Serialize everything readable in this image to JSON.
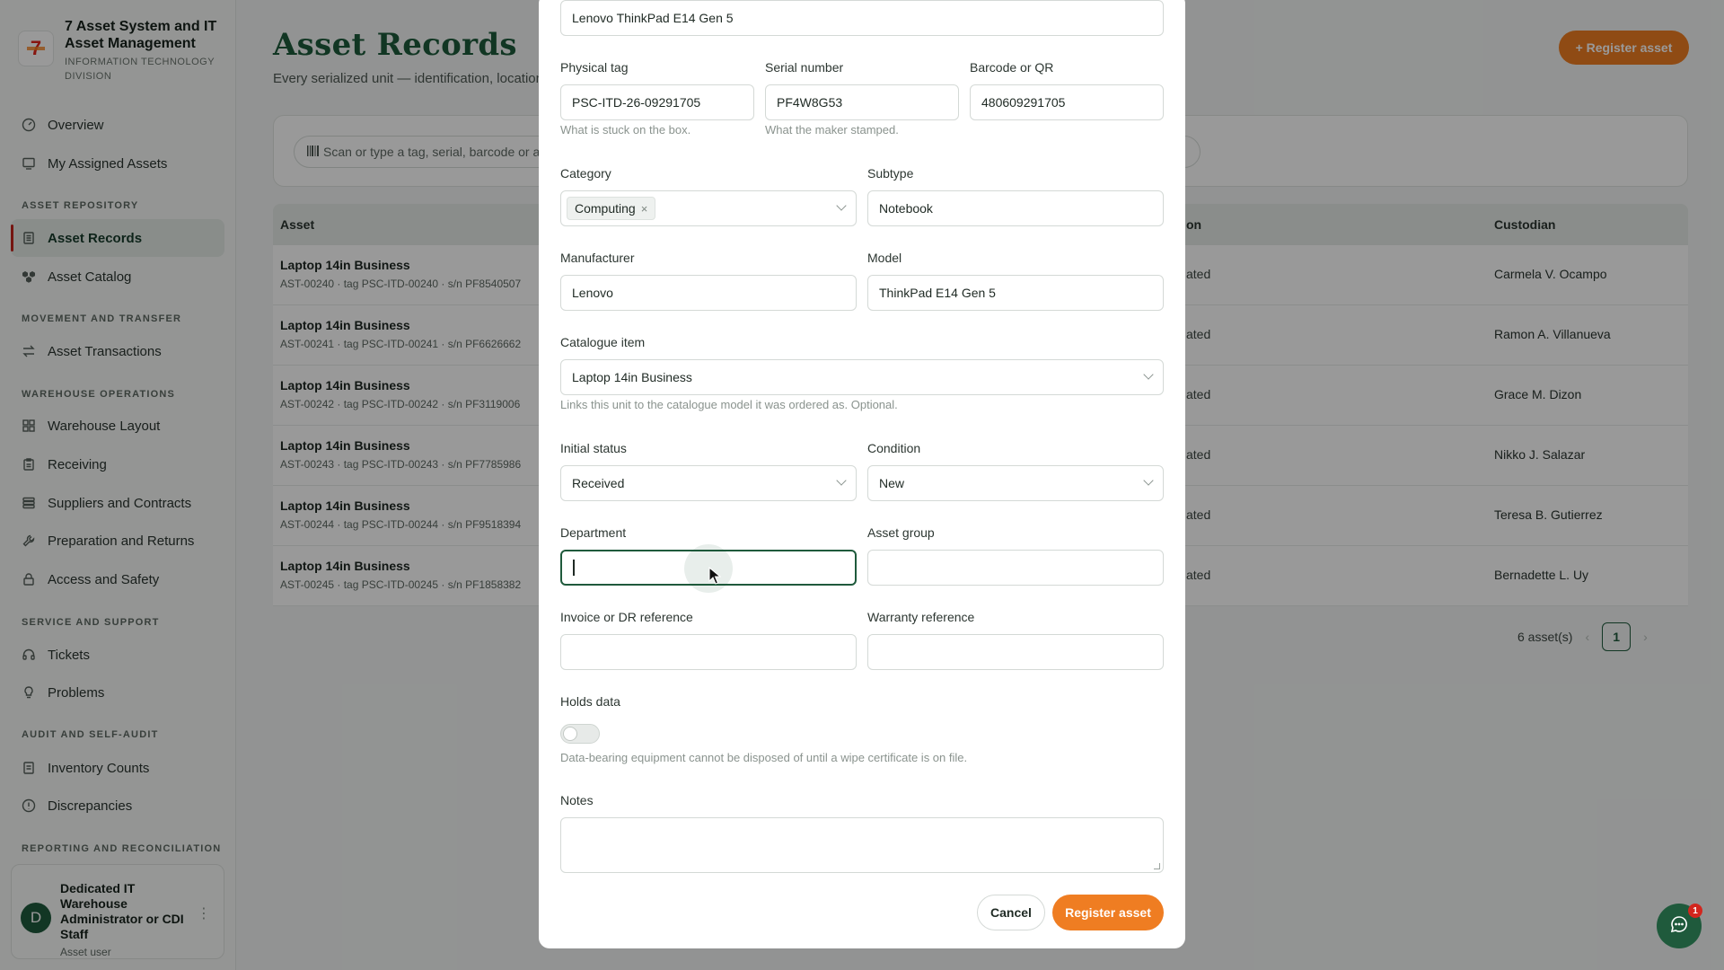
{
  "brand": {
    "title": "7 Asset System and IT Asset Management",
    "subtitle": "INFORMATION TECHNOLOGY DIVISION"
  },
  "sidebar": {
    "items": [
      {
        "label": "Overview",
        "icon": "gauge-icon"
      },
      {
        "label": "My Assigned Assets",
        "icon": "monitor-icon"
      },
      {
        "label": "Asset Records",
        "icon": "records-icon"
      },
      {
        "label": "Asset Catalog",
        "icon": "boxes-icon"
      },
      {
        "label": "Asset Transactions",
        "icon": "transfer-icon"
      },
      {
        "label": "Warehouse Layout",
        "icon": "grid-icon"
      },
      {
        "label": "Receiving",
        "icon": "clipboard-icon"
      },
      {
        "label": "Suppliers and Contracts",
        "icon": "stack-icon"
      },
      {
        "label": "Preparation and Returns",
        "icon": "wrench-icon"
      },
      {
        "label": "Access and Safety",
        "icon": "lock-icon"
      },
      {
        "label": "Tickets",
        "icon": "headset-icon"
      },
      {
        "label": "Problems",
        "icon": "lightbulb-icon"
      },
      {
        "label": "Inventory Counts",
        "icon": "list-icon"
      },
      {
        "label": "Discrepancies",
        "icon": "alert-circle-icon"
      }
    ],
    "sections": [
      "ASSET REPOSITORY",
      "MOVEMENT AND TRANSFER",
      "WAREHOUSE OPERATIONS",
      "SERVICE AND SUPPORT",
      "AUDIT AND SELF-AUDIT",
      "REPORTING AND RECONCILIATION"
    ],
    "active": "Asset Records"
  },
  "user": {
    "initial": "D",
    "name": "Dedicated IT Warehouse Administrator or CDI Staff",
    "role": "Asset user"
  },
  "main": {
    "title": "Asset Records",
    "subtitle": "Every serialized unit — identification, location",
    "register_button": "+ Register asset",
    "search_placeholder": "Scan or type a tag, serial, barcode or as",
    "columns": [
      "Asset",
      "on",
      "Custodian"
    ],
    "rows": [
      {
        "name": "Laptop 14in Business",
        "meta": "AST-00240 · tag PSC-ITD-00240 · s/n PF8540507",
        "status": "ated",
        "custodian": "Carmela V. Ocampo"
      },
      {
        "name": "Laptop 14in Business",
        "meta": "AST-00241 · tag PSC-ITD-00241 · s/n PF6626662",
        "status": "ated",
        "custodian": "Ramon A. Villanueva"
      },
      {
        "name": "Laptop 14in Business",
        "meta": "AST-00242 · tag PSC-ITD-00242 · s/n PF3119006",
        "status": "ated",
        "custodian": "Grace M. Dizon"
      },
      {
        "name": "Laptop 14in Business",
        "meta": "AST-00243 · tag PSC-ITD-00243 · s/n PF7785986",
        "status": "ated",
        "custodian": "Nikko J. Salazar"
      },
      {
        "name": "Laptop 14in Business",
        "meta": "AST-00244 · tag PSC-ITD-00244 · s/n PF9518394",
        "status": "ated",
        "custodian": "Teresa B. Gutierrez"
      },
      {
        "name": "Laptop 14in Business",
        "meta": "AST-00245 · tag PSC-ITD-00245 · s/n PF1858382",
        "status": "ated",
        "custodian": "Bernadette L. Uy"
      }
    ],
    "pager": {
      "count": "6 asset(s)",
      "page": "1",
      "prev": "‹",
      "next": "›"
    }
  },
  "modal": {
    "name_value": "Lenovo ThinkPad E14 Gen 5",
    "physical_tag": {
      "label": "Physical tag",
      "value": "PSC-ITD-26-09291705",
      "hint": "What is stuck on the box."
    },
    "serial": {
      "label": "Serial number",
      "value": "PF4W8G53",
      "hint": "What the maker stamped."
    },
    "barcode": {
      "label": "Barcode or QR",
      "value": "480609291705"
    },
    "category": {
      "label": "Category",
      "chip": "Computing",
      "chip_remove": "×"
    },
    "subtype": {
      "label": "Subtype",
      "value": "Notebook"
    },
    "manufacturer": {
      "label": "Manufacturer",
      "value": "Lenovo"
    },
    "model": {
      "label": "Model",
      "value": "ThinkPad E14 Gen 5"
    },
    "catalogue": {
      "label": "Catalogue item",
      "value": "Laptop 14in Business",
      "hint": "Links this unit to the catalogue model it was ordered as. Optional."
    },
    "initial_status": {
      "label": "Initial status",
      "value": "Received"
    },
    "condition": {
      "label": "Condition",
      "value": "New"
    },
    "department": {
      "label": "Department",
      "value": ""
    },
    "asset_group": {
      "label": "Asset group",
      "value": ""
    },
    "invoice": {
      "label": "Invoice or DR reference",
      "value": ""
    },
    "warranty": {
      "label": "Warranty reference",
      "value": ""
    },
    "holds_data": {
      "label": "Holds data",
      "on": false,
      "hint": "Data-bearing equipment cannot be disposed of until a wipe certificate is on file."
    },
    "notes": {
      "label": "Notes",
      "value": ""
    },
    "cancel": "Cancel",
    "submit": "Register asset"
  },
  "chat": {
    "badge": "1"
  },
  "colors": {
    "accent": "#ef7d22",
    "brand_green": "#1f5a3c",
    "active_marker": "#c4261d"
  }
}
